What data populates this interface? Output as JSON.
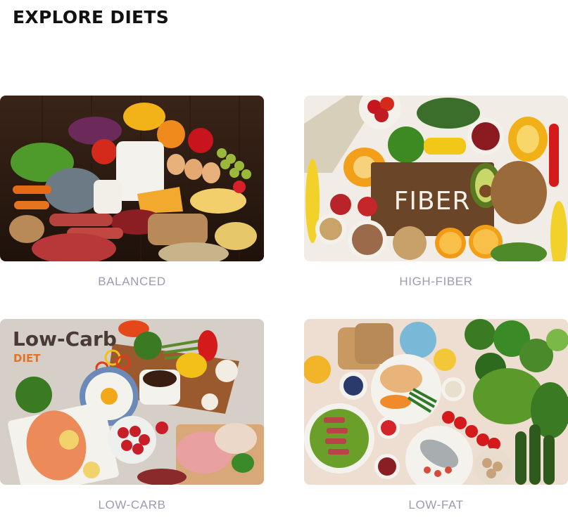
{
  "page": {
    "title": "EXPLORE DIETS"
  },
  "diets": [
    {
      "label": "BALANCED",
      "image": "balanced-food-photo"
    },
    {
      "label": "HIGH-FIBER",
      "image": "high-fiber-food-photo",
      "image_text": "FIBER"
    },
    {
      "label": "LOW-CARB",
      "image": "low-carb-food-photo",
      "image_text": "Low-Carb",
      "image_subtext": "DIET"
    },
    {
      "label": "LOW-FAT",
      "image": "low-fat-food-photo"
    }
  ],
  "colors": {
    "title": "#111111",
    "caption": "#9a9cb0",
    "lowcarb_accent": "#e0732a"
  }
}
